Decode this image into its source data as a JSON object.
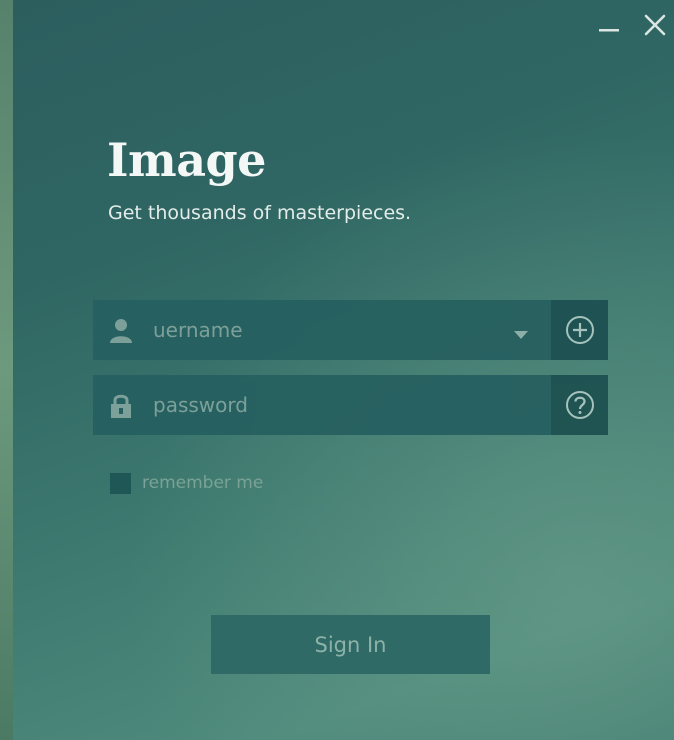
{
  "window": {
    "controls": {
      "minimize_icon": "minimize-icon",
      "close_icon": "close-icon"
    }
  },
  "brand": {
    "title": "Image",
    "subtitle": "Get thousands of masterpieces."
  },
  "login_form": {
    "username": {
      "placeholder": "uername",
      "value": "",
      "icon": "user-icon",
      "dropdown_icon": "caret-down-icon",
      "action_icon": "plus-circle-icon"
    },
    "password": {
      "placeholder": "password",
      "value": "",
      "icon": "lock-icon",
      "action_icon": "help-circle-icon"
    },
    "remember_label": "remember me",
    "remember_checked": false,
    "signin_label": "Sign In"
  },
  "colors": {
    "background": "#2f6663",
    "field_background": "#276060",
    "action_button": "#1e5252",
    "signin_button": "#2f6a66",
    "title_text": "#f3f7f5"
  }
}
